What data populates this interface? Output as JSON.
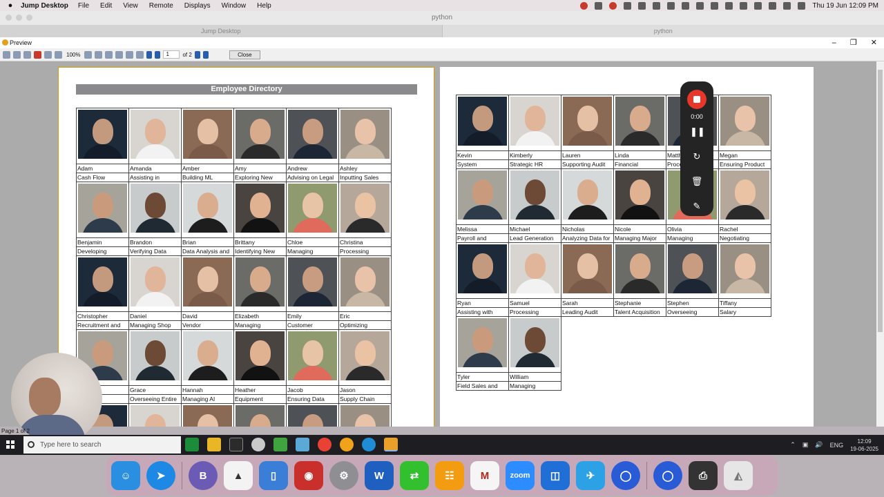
{
  "mac_menubar": {
    "app_name": "Jump Desktop",
    "menus": [
      "File",
      "Edit",
      "View",
      "Remote",
      "Displays",
      "Window",
      "Help"
    ],
    "clock": "Thu 19 Jun  12:09 PM"
  },
  "jump": {
    "window_title": "python",
    "tabs": [
      "Jump Desktop",
      "python"
    ]
  },
  "preview": {
    "title": "Preview",
    "zoom": "100%",
    "page_value": "1",
    "of_pages": "of 2",
    "close_label": "Close",
    "status": "Page 1 of 2"
  },
  "directory": {
    "title": "Employee Directory",
    "page1": [
      {
        "name": "Adam",
        "role": "Cash Flow"
      },
      {
        "name": "Amanda",
        "role": "Assisting in"
      },
      {
        "name": "Amber",
        "role": "Building ML"
      },
      {
        "name": "Amy",
        "role": "Exploring New"
      },
      {
        "name": "Andrew",
        "role": "Advising on Legal"
      },
      {
        "name": "Ashley",
        "role": "Inputting Sales"
      },
      {
        "name": "Benjamin",
        "role": "Developing"
      },
      {
        "name": "Brandon",
        "role": "Verifying Data"
      },
      {
        "name": "Brian",
        "role": "Data Analysis and"
      },
      {
        "name": "Brittany",
        "role": "Identifying New"
      },
      {
        "name": "Chloe",
        "role": "Managing"
      },
      {
        "name": "Christina",
        "role": "Processing"
      },
      {
        "name": "Christopher",
        "role": "Recruitment and"
      },
      {
        "name": "Daniel",
        "role": "Managing Shop"
      },
      {
        "name": "David",
        "role": "Vendor"
      },
      {
        "name": "Elizabeth",
        "role": "Managing"
      },
      {
        "name": "Emily",
        "role": "Customer"
      },
      {
        "name": "Eric",
        "role": "Optimizing"
      },
      {
        "name": "",
        "role": "ing"
      },
      {
        "name": "Grace",
        "role": "Overseeing Entire"
      },
      {
        "name": "Hannah",
        "role": "Managing AI"
      },
      {
        "name": "Heather",
        "role": "Equipment"
      },
      {
        "name": "Jacob",
        "role": "Ensuring Data"
      },
      {
        "name": "Jason",
        "role": "Supply Chain"
      },
      {
        "name": "",
        "role": ""
      },
      {
        "name": "",
        "role": ""
      },
      {
        "name": "",
        "role": ""
      },
      {
        "name": "",
        "role": ""
      },
      {
        "name": "",
        "role": ""
      },
      {
        "name": "",
        "role": ""
      }
    ],
    "page2": [
      {
        "name": "Kevin",
        "role": "System"
      },
      {
        "name": "Kimberly",
        "role": "Strategic HR"
      },
      {
        "name": "Lauren",
        "role": "Supporting Audit"
      },
      {
        "name": "Linda",
        "role": "Financial"
      },
      {
        "name": "Matth",
        "role": "Proce"
      },
      {
        "name": "Megan",
        "role": "Ensuring Product"
      },
      {
        "name": "Melissa",
        "role": "Payroll and"
      },
      {
        "name": "Michael",
        "role": "Lead Generation"
      },
      {
        "name": "Nicholas",
        "role": "Analyzing Data for"
      },
      {
        "name": "Nicole",
        "role": "Managing Major"
      },
      {
        "name": "Olivia",
        "role": "Managing"
      },
      {
        "name": "Rachel",
        "role": "Negotiating"
      },
      {
        "name": "Ryan",
        "role": "Assisting with"
      },
      {
        "name": "Samuel",
        "role": "Processing"
      },
      {
        "name": "Sarah",
        "role": "Leading Audit"
      },
      {
        "name": "Stephanie",
        "role": "Talent Acquisition"
      },
      {
        "name": "Stephen",
        "role": "Overseeing"
      },
      {
        "name": "Tiffany",
        "role": "Salary"
      },
      {
        "name": "Tyler",
        "role": "Field Sales and"
      },
      {
        "name": "William",
        "role": "Managing"
      }
    ]
  },
  "recorder": {
    "time": "0:00"
  },
  "taskbar": {
    "search_placeholder": "Type here to search",
    "lang": "ENG",
    "time": "12:09",
    "date": "19-06-2025"
  },
  "dock": {
    "zoom_label": "zoom"
  },
  "colors": {
    "accent_red": "#e5382b",
    "header_gray": "#8a8a8d",
    "page_border": "#d5a100"
  }
}
